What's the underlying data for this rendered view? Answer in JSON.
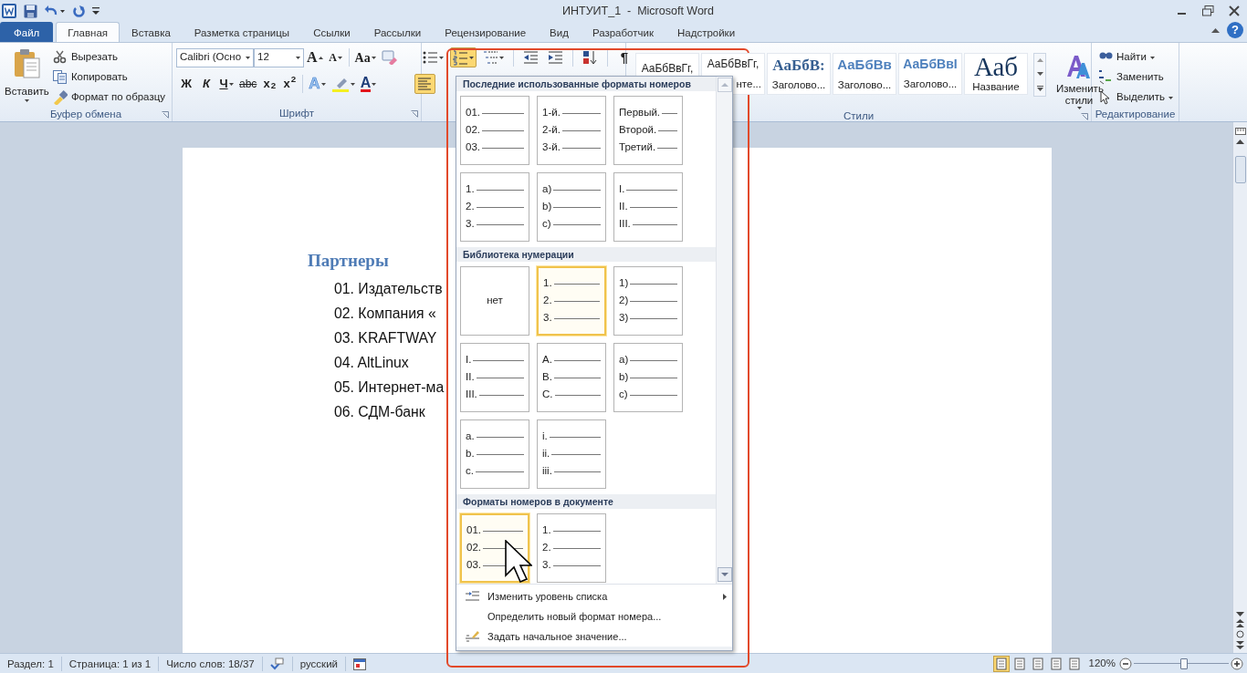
{
  "window": {
    "title": "ИНТУИТ_1  -  Microsoft Word",
    "help": "?"
  },
  "tabs": [
    {
      "label": "Файл",
      "kind": "file",
      "selected": false
    },
    {
      "label": "Главная",
      "kind": "tab",
      "selected": true
    },
    {
      "label": "Вставка",
      "kind": "tab",
      "selected": false
    },
    {
      "label": "Разметка страницы",
      "kind": "tab",
      "selected": false
    },
    {
      "label": "Ссылки",
      "kind": "tab",
      "selected": false
    },
    {
      "label": "Рассылки",
      "kind": "tab",
      "selected": false
    },
    {
      "label": "Рецензирование",
      "kind": "tab",
      "selected": false
    },
    {
      "label": "Вид",
      "kind": "tab",
      "selected": false
    },
    {
      "label": "Разработчик",
      "kind": "tab",
      "selected": false
    },
    {
      "label": "Надстройки",
      "kind": "tab",
      "selected": false
    }
  ],
  "clipboard": {
    "label": "Буфер обмена",
    "paste": "Вставить",
    "items": [
      {
        "label": "Вырезать",
        "kind": "cut"
      },
      {
        "label": "Копировать",
        "kind": "copy"
      },
      {
        "label": "Формат по образцу",
        "kind": "painter"
      }
    ]
  },
  "font": {
    "label": "Шрифт",
    "name": "Calibri (Осно",
    "size": "12",
    "row1": [
      {
        "kind": "grow",
        "text": "A",
        "dropdown": false
      },
      {
        "kind": "shrink",
        "text": "A",
        "dropdown": false
      },
      {
        "kind": "case",
        "text": "Aa",
        "dropdown": true
      },
      {
        "kind": "clear",
        "dropdown": false
      }
    ],
    "row2": [
      {
        "kind": "bold",
        "text": "Ж",
        "dropdown": false
      },
      {
        "kind": "italic",
        "text": "К",
        "dropdown": false
      },
      {
        "kind": "underline",
        "text": "Ч",
        "dropdown": true
      },
      {
        "kind": "strike",
        "text": "abc",
        "dropdown": false
      },
      {
        "kind": "sub",
        "text": "x$_{2}$",
        "dropdown": false
      },
      {
        "kind": "sup",
        "text": "x$^{2}$",
        "dropdown": false
      },
      {
        "kind": "effects",
        "text": "A",
        "dropdown": true
      },
      {
        "kind": "highlight",
        "dropdown": true
      },
      {
        "kind": "color",
        "text": "A",
        "dropdown": true
      }
    ]
  },
  "paragraph": {
    "row1": [
      {
        "kind": "bullets",
        "selected": false
      },
      {
        "kind": "numbering",
        "selected": true
      },
      {
        "kind": "multilevel",
        "selected": false
      },
      {
        "kind": "outdent",
        "selected": false
      },
      {
        "kind": "indent",
        "selected": false
      },
      {
        "kind": "sort",
        "selected": false
      },
      {
        "kind": "marks",
        "text": "¶",
        "selected": false
      }
    ],
    "row2": [
      {
        "kind": "align-left",
        "selected": true
      }
    ]
  },
  "styles": {
    "label": "Стили",
    "change": "Изменить стили",
    "items": [
      {
        "preview": "АаБбВвГг,",
        "kind": "normal"
      },
      {
        "preview": "АаБбВвГг,",
        "label": "нте...",
        "kind": "normal"
      },
      {
        "preview": "АаБбВ:",
        "label": "Заголово...",
        "kind": "heading1"
      },
      {
        "preview": "АаБбВв",
        "label": "Заголово...",
        "kind": "heading2"
      },
      {
        "preview": "АаБбВвI",
        "label": "Заголово...",
        "kind": "heading3"
      },
      {
        "preview": "Ааб",
        "label": "Название",
        "kind": "title"
      }
    ]
  },
  "editing": {
    "label": "Редактирование",
    "items": [
      {
        "label": "Найти",
        "kind": "find",
        "dropdown": true
      },
      {
        "label": "Заменить",
        "kind": "replace",
        "dropdown": false
      },
      {
        "label": "Выделить",
        "kind": "select",
        "dropdown": true
      }
    ]
  },
  "document": {
    "heading": "Партнеры",
    "items": [
      "01. Издательств",
      "02. Компания «",
      "03. KRAFTWAY",
      "04. AltLinux",
      "05. Интернет-ма",
      "06. СДМ-банк"
    ]
  },
  "numbering_menu": {
    "sections": [
      {
        "title": "Последние использованные форматы номеров",
        "formats": [
          {
            "lines": [
              "01.",
              "02.",
              "03."
            ],
            "selected": false
          },
          {
            "lines": [
              "1-й.",
              "2-й.",
              "3-й."
            ],
            "selected": false
          },
          {
            "lines": [
              "Первый.",
              "Второй.",
              "Третий."
            ],
            "selected": false
          },
          {
            "lines": [
              "1.",
              "2.",
              "3."
            ],
            "selected": false
          },
          {
            "lines": [
              "a)",
              "b)",
              "c)"
            ],
            "selected": false
          },
          {
            "lines": [
              "I.",
              "II.",
              "III."
            ],
            "selected": false
          }
        ]
      },
      {
        "title": "Библиотека нумерации",
        "formats": [
          {
            "text": "нет",
            "selected": false
          },
          {
            "lines": [
              "1.",
              "2.",
              "3."
            ],
            "selected": true
          },
          {
            "lines": [
              "1)",
              "2)",
              "3)"
            ],
            "selected": false
          },
          {
            "lines": [
              "I.",
              "II.",
              "III."
            ],
            "selected": false
          },
          {
            "lines": [
              "A.",
              "B.",
              "C."
            ],
            "selected": false
          },
          {
            "lines": [
              "a)",
              "b)",
              "c)"
            ],
            "selected": false
          },
          {
            "lines": [
              "a.",
              "b.",
              "c."
            ],
            "selected": false
          },
          {
            "lines": [
              "i.",
              "ii.",
              "iii."
            ],
            "selected": false
          }
        ]
      },
      {
        "title": "Форматы номеров в документе",
        "formats": [
          {
            "lines": [
              "01.",
              "02.",
              "03."
            ],
            "selected": true
          },
          {
            "lines": [
              "1.",
              "2.",
              "3."
            ],
            "selected": false
          }
        ]
      }
    ],
    "commands": [
      {
        "label": "Изменить уровень списка",
        "kind": "level",
        "submenu": true
      },
      {
        "label": "Определить новый формат номера...",
        "kind": "define",
        "submenu": false
      },
      {
        "label": "Задать начальное значение...",
        "kind": "start",
        "submenu": false
      }
    ]
  },
  "status_bar": {
    "items": [
      "Раздел: 1",
      "Страница: 1 из 1",
      "Число слов: 18/37"
    ],
    "language": "русский",
    "zoom": "120%",
    "zoom_slider": {
      "level": 0.53
    }
  }
}
